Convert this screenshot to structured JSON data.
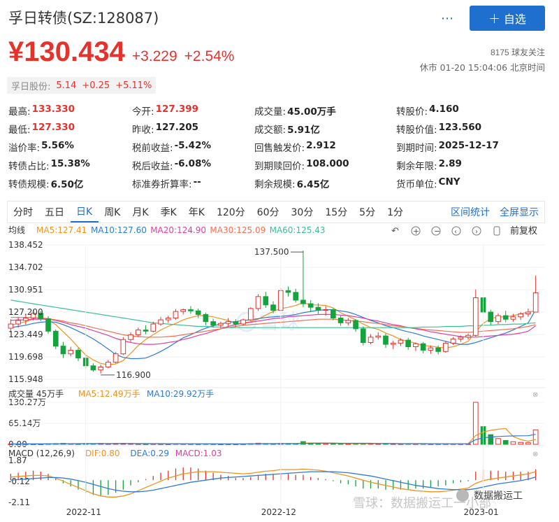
{
  "header": {
    "title": "孚日转债(SZ:128087)",
    "more_icon": "⋯",
    "follow_label": "自选"
  },
  "price": {
    "current": "¥130.434",
    "change": "+3.229",
    "change_pct": "+2.54%",
    "followers": "8175 球友关注",
    "status": "休市 01-20 15:04:06 北京时间"
  },
  "stock_link": {
    "name": "孚日股份:",
    "price": "5.14",
    "change": "+0.25",
    "change_pct": "+5.11%"
  },
  "quote": [
    [
      {
        "label": "最高:",
        "value": "133.330",
        "red": true
      },
      {
        "label": "今开:",
        "value": "127.399",
        "red": true
      },
      {
        "label": "成交量:",
        "value": "45.00万手"
      },
      {
        "label": "转股价:",
        "value": "4.160"
      }
    ],
    [
      {
        "label": "最低:",
        "value": "127.330",
        "red": true
      },
      {
        "label": "昨收:",
        "value": "127.205"
      },
      {
        "label": "成交额:",
        "value": "5.91亿"
      },
      {
        "label": "转股价值:",
        "value": "123.560"
      }
    ],
    [
      {
        "label": "溢价率:",
        "value": "5.56%"
      },
      {
        "label": "税前收益:",
        "value": "-5.42%"
      },
      {
        "label": "回售触发价:",
        "value": "2.912"
      },
      {
        "label": "到期时间:",
        "value": "2025-12-17"
      }
    ],
    [
      {
        "label": "转债占比:",
        "value": "15.38%"
      },
      {
        "label": "税后收益:",
        "value": "-6.08%"
      },
      {
        "label": "到期赎回价:",
        "value": "108.000"
      },
      {
        "label": "剩余年限:",
        "value": "2.89"
      }
    ],
    [
      {
        "label": "转债规模:",
        "value": "6.50亿"
      },
      {
        "label": "标准券折算率:",
        "value": "--"
      },
      {
        "label": "剩余规模:",
        "value": "6.45亿"
      },
      {
        "label": "货币单位:",
        "value": "CNY"
      }
    ]
  ],
  "tabs": {
    "items": [
      "分时",
      "五日",
      "日K",
      "周K",
      "月K",
      "季K",
      "年K",
      "120分",
      "60分",
      "30分",
      "15分",
      "5分",
      "1分"
    ],
    "active": 2,
    "range_stats": "区间统计",
    "fullscreen": "全屏显示"
  },
  "colors": {
    "up": "#e5322d",
    "down": "#14a33c",
    "accent": "#1e6fce",
    "ma5": "#f0921e",
    "ma10": "#2d7bd6",
    "ma20": "#e040a0",
    "ma30": "#f07050",
    "ma60": "#3cc090"
  },
  "chart_data": {
    "type": "candlestick",
    "ma_label": "均线",
    "ma_legend": [
      "MA5:127.41",
      "MA10:127.60",
      "MA20:124.90",
      "MA30:125.09",
      "MA60:125.43"
    ],
    "adjust_label": "前复权",
    "y_ticks": [
      "138.452",
      "134.702",
      "130.951",
      "127.200",
      "123.449",
      "119.698",
      "115.948"
    ],
    "ylim": [
      115.948,
      138.452
    ],
    "max_label": "137.500",
    "min_label": "116.900",
    "candles": [
      [
        124.5,
        126.0,
        125.2,
        123.8
      ],
      [
        125.2,
        126.4,
        125.8,
        124.6
      ],
      [
        125.8,
        126.8,
        126.2,
        125.1
      ],
      [
        126.2,
        127.6,
        127.0,
        125.8
      ],
      [
        127.0,
        127.4,
        126.1,
        125.7
      ],
      [
        126.1,
        126.5,
        124.0,
        123.6
      ],
      [
        124.0,
        124.3,
        121.5,
        121.0
      ],
      [
        121.5,
        122.2,
        120.2,
        119.5
      ],
      [
        120.2,
        121.4,
        120.8,
        119.8
      ],
      [
        120.8,
        121.2,
        119.5,
        119.0
      ],
      [
        119.5,
        120.1,
        118.2,
        117.8
      ],
      [
        118.2,
        118.6,
        117.5,
        117.2
      ],
      [
        117.5,
        118.4,
        118.0,
        116.9
      ],
      [
        118.0,
        119.2,
        118.8,
        117.8
      ],
      [
        118.8,
        120.5,
        120.2,
        118.6
      ],
      [
        120.2,
        123.0,
        122.6,
        120.0
      ],
      [
        122.6,
        123.8,
        123.4,
        122.2
      ],
      [
        123.4,
        124.6,
        124.2,
        123.0
      ],
      [
        124.2,
        125.0,
        124.0,
        123.5
      ],
      [
        124.0,
        125.6,
        125.2,
        123.8
      ],
      [
        125.2,
        126.4,
        125.9,
        124.9
      ],
      [
        125.9,
        126.6,
        126.2,
        125.4
      ],
      [
        126.2,
        127.7,
        127.3,
        125.9
      ],
      [
        127.3,
        127.8,
        127.6,
        126.8
      ],
      [
        127.6,
        128.2,
        127.4,
        126.9
      ],
      [
        127.4,
        127.8,
        126.8,
        126.2
      ],
      [
        126.8,
        127.1,
        125.6,
        125.0
      ],
      [
        125.6,
        126.1,
        125.0,
        124.6
      ],
      [
        125.0,
        125.6,
        125.3,
        124.5
      ],
      [
        125.3,
        126.2,
        125.6,
        124.8
      ],
      [
        125.6,
        126.0,
        125.2,
        124.7
      ],
      [
        125.2,
        126.1,
        125.9,
        124.9
      ],
      [
        125.9,
        128.0,
        127.8,
        125.7
      ],
      [
        127.8,
        130.2,
        129.8,
        127.4
      ],
      [
        129.8,
        130.6,
        128.4,
        127.9
      ],
      [
        128.4,
        129.0,
        127.5,
        127.0
      ],
      [
        127.5,
        131.2,
        130.8,
        127.3
      ],
      [
        130.8,
        131.5,
        130.5,
        129.8
      ],
      [
        130.5,
        131.1,
        129.2,
        128.8
      ],
      [
        129.2,
        137.5,
        128.6,
        128.0
      ],
      [
        128.6,
        129.2,
        128.0,
        127.2
      ],
      [
        128.0,
        128.7,
        127.5,
        126.9
      ],
      [
        127.5,
        128.2,
        127.6,
        126.6
      ],
      [
        127.6,
        127.9,
        126.2,
        125.8
      ],
      [
        126.2,
        126.6,
        125.4,
        124.9
      ],
      [
        125.4,
        126.2,
        125.8,
        125.0
      ],
      [
        125.8,
        126.0,
        124.4,
        123.9
      ],
      [
        124.4,
        124.8,
        122.1,
        121.6
      ],
      [
        122.1,
        123.5,
        123.0,
        121.8
      ],
      [
        123.0,
        123.8,
        123.2,
        122.6
      ],
      [
        123.2,
        123.6,
        121.8,
        121.2
      ],
      [
        121.8,
        122.4,
        122.0,
        121.0
      ],
      [
        122.0,
        122.8,
        122.5,
        121.5
      ],
      [
        122.5,
        122.9,
        121.4,
        120.9
      ],
      [
        121.4,
        122.1,
        121.9,
        120.7
      ],
      [
        121.9,
        122.2,
        120.8,
        120.3
      ],
      [
        120.8,
        121.6,
        121.2,
        120.2
      ],
      [
        121.2,
        121.6,
        120.6,
        120.1
      ],
      [
        120.6,
        122.4,
        122.0,
        120.4
      ],
      [
        122.0,
        123.0,
        122.7,
        121.7
      ],
      [
        122.7,
        123.3,
        123.0,
        122.2
      ],
      [
        123.0,
        123.6,
        123.3,
        122.6
      ],
      [
        123.3,
        131.0,
        129.6,
        123.1
      ],
      [
        129.6,
        130.4,
        127.2,
        126.8
      ],
      [
        127.2,
        127.6,
        125.6,
        125.0
      ],
      [
        125.6,
        127.0,
        126.6,
        125.2
      ],
      [
        126.6,
        127.4,
        126.0,
        125.5
      ],
      [
        126.0,
        126.9,
        126.4,
        125.6
      ],
      [
        126.4,
        127.2,
        126.9,
        125.9
      ],
      [
        126.9,
        127.8,
        127.2,
        126.4
      ],
      [
        127.2,
        133.33,
        130.434,
        127.2
      ]
    ],
    "ma_series": {
      "ma5": [
        125.0,
        125.3,
        125.6,
        126.0,
        126.1,
        125.9,
        125.1,
        123.9,
        122.7,
        121.3,
        120.0,
        119.2,
        118.6,
        118.4,
        118.5,
        119.1,
        120.3,
        121.6,
        122.6,
        123.4,
        124.2,
        124.8,
        125.3,
        125.9,
        126.3,
        126.6,
        126.6,
        126.4,
        126.1,
        125.8,
        125.3,
        125.4,
        125.6,
        126.0,
        126.7,
        127.3,
        127.8,
        128.0,
        128.3,
        128.8,
        128.4,
        128.4,
        128.3,
        127.9,
        127.1,
        126.5,
        125.9,
        125.2,
        124.6,
        124.3,
        123.7,
        123.2,
        122.6,
        122.3,
        122.0,
        121.6,
        121.5,
        121.3,
        121.2,
        121.4,
        121.8,
        122.3,
        123.9,
        125.3,
        126.1,
        126.4,
        126.4,
        126.6,
        126.9,
        127.2,
        127.4
      ],
      "ma10": [
        124.6,
        124.8,
        125.0,
        125.3,
        125.5,
        125.6,
        125.5,
        125.1,
        124.6,
        124.0,
        123.4,
        122.7,
        121.9,
        121.0,
        120.1,
        119.6,
        119.4,
        119.4,
        119.5,
        120.0,
        120.6,
        121.3,
        122.1,
        122.9,
        123.4,
        124.0,
        124.5,
        124.9,
        125.2,
        125.5,
        125.6,
        125.8,
        125.9,
        126.1,
        126.3,
        126.4,
        126.5,
        126.6,
        126.8,
        127.1,
        127.3,
        127.5,
        127.6,
        127.6,
        127.4,
        127.2,
        126.8,
        126.3,
        125.8,
        125.4,
        124.9,
        124.6,
        124.2,
        123.9,
        123.6,
        123.2,
        122.9,
        122.6,
        122.3,
        122.0,
        121.8,
        121.8,
        122.1,
        122.5,
        122.9,
        123.3,
        123.7,
        124.2,
        124.8,
        125.4,
        127.6
      ],
      "ma20": [
        125.8,
        125.9,
        125.9,
        126.0,
        126.0,
        126.0,
        125.8,
        125.5,
        125.1,
        124.8,
        124.5,
        124.1,
        123.7,
        123.3,
        122.8,
        122.4,
        122.1,
        121.9,
        121.8,
        121.8,
        121.9,
        122.1,
        122.3,
        122.6,
        122.9,
        123.3,
        123.6,
        124.0,
        124.4,
        124.8,
        125.1,
        125.3,
        125.5,
        125.7,
        125.9,
        126.1,
        126.2,
        126.4,
        126.5,
        126.6,
        126.7,
        126.8,
        126.8,
        126.8,
        126.7,
        126.6,
        126.4,
        126.2,
        125.9,
        125.7,
        125.4,
        125.1,
        124.9,
        124.6,
        124.4,
        124.2,
        123.9,
        123.7,
        123.5,
        123.3,
        123.1,
        123.0,
        123.0,
        123.1,
        123.2,
        123.3,
        123.4,
        123.5,
        123.7,
        124.0,
        124.9
      ],
      "ma30": [
        126.3,
        126.3,
        126.3,
        126.3,
        126.2,
        126.1,
        125.9,
        125.7,
        125.4,
        125.2,
        124.9,
        124.6,
        124.3,
        124.0,
        123.7,
        123.4,
        123.2,
        123.1,
        123.0,
        123.0,
        123.0,
        123.1,
        123.2,
        123.4,
        123.6,
        123.8,
        124.0,
        124.2,
        124.4,
        124.6,
        124.8,
        125.0,
        125.1,
        125.2,
        125.3,
        125.4,
        125.5,
        125.6,
        125.7,
        125.8,
        125.9,
        126.0,
        126.0,
        126.0,
        125.9,
        125.8,
        125.7,
        125.6,
        125.4,
        125.3,
        125.1,
        124.9,
        124.8,
        124.6,
        124.5,
        124.3,
        124.2,
        124.1,
        124.0,
        123.9,
        123.8,
        123.8,
        123.9,
        124.0,
        124.1,
        124.2,
        124.3,
        124.4,
        124.6,
        124.8,
        125.1
      ],
      "ma60": [
        129.2,
        129.0,
        128.8,
        128.6,
        128.4,
        128.2,
        128.0,
        127.8,
        127.6,
        127.4,
        127.2,
        127.0,
        126.8,
        126.6,
        126.4,
        126.2,
        126.0,
        125.8,
        125.6,
        125.4,
        125.3,
        125.2,
        125.1,
        125.0,
        124.9,
        124.8,
        124.8,
        124.7,
        124.7,
        124.6,
        124.6,
        124.6,
        124.6,
        124.6,
        124.6,
        124.6,
        124.6,
        124.6,
        124.6,
        124.6,
        124.6,
        124.6,
        124.6,
        124.6,
        124.6,
        124.6,
        124.6,
        124.6,
        124.6,
        124.6,
        124.6,
        124.6,
        124.6,
        124.6,
        124.6,
        124.7,
        124.7,
        124.7,
        124.8,
        124.8,
        124.8,
        124.9,
        124.9,
        125.0,
        125.0,
        125.1,
        125.1,
        125.2,
        125.2,
        125.3,
        125.4
      ]
    },
    "volume": {
      "label": "成交量 45万手",
      "ma_legend": [
        "MA5:12.49万手",
        "MA10:29.92万手"
      ],
      "y_ticks": [
        "130.27万",
        "65.14万",
        "0.00"
      ],
      "ylim": [
        0,
        130.27
      ],
      "values": [
        1.2,
        1.0,
        1.5,
        1.3,
        1.1,
        2.0,
        2.5,
        3.2,
        2.1,
        1.8,
        2.6,
        2.2,
        2.8,
        1.9,
        2.4,
        3.1,
        2.2,
        1.6,
        1.4,
        1.7,
        1.5,
        1.3,
        2.0,
        1.8,
        1.6,
        1.4,
        1.9,
        1.5,
        1.2,
        1.3,
        1.1,
        1.4,
        2.3,
        3.5,
        2.6,
        2.0,
        3.0,
        2.4,
        2.2,
        8.5,
        4.2,
        3.1,
        2.5,
        2.8,
        2.1,
        1.7,
        2.6,
        3.2,
        2.4,
        1.9,
        2.3,
        1.8,
        1.6,
        2.0,
        1.7,
        1.9,
        1.5,
        1.6,
        1.8,
        1.7,
        1.5,
        1.6,
        130.27,
        55.0,
        30.0,
        18.0,
        12.0,
        8.0,
        6.0,
        5.0,
        45.0
      ]
    },
    "macd": {
      "label": "MACD (12,26,9)",
      "legend": [
        "DIF:0.80",
        "DEA:0.29",
        "MACD:1.03"
      ],
      "y_ticks": [
        "1.87",
        "-0.12",
        "-2.11"
      ],
      "ylim": [
        -2.11,
        1.87
      ],
      "hist": [
        0.6,
        0.7,
        0.8,
        0.9,
        0.8,
        0.6,
        0.2,
        -0.3,
        -0.6,
        -0.9,
        -1.2,
        -1.4,
        -1.5,
        -1.4,
        -1.2,
        -0.9,
        -0.5,
        -0.2,
        0.1,
        0.4,
        0.7,
        0.9,
        1.1,
        1.2,
        1.2,
        1.1,
        0.9,
        0.7,
        0.5,
        0.4,
        0.2,
        0.2,
        0.3,
        0.5,
        0.6,
        0.6,
        0.7,
        0.6,
        0.5,
        0.5,
        0.3,
        0.2,
        0.1,
        -0.1,
        -0.3,
        -0.4,
        -0.6,
        -0.8,
        -0.8,
        -0.8,
        -0.9,
        -0.9,
        -0.9,
        -0.9,
        -0.8,
        -0.8,
        -0.7,
        -0.6,
        -0.5,
        -0.3,
        -0.2,
        -0.1,
        0.8,
        1.0,
        0.9,
        0.9,
        0.8,
        0.8,
        0.8,
        0.8,
        1.03
      ],
      "dif": [
        0.3,
        0.35,
        0.4,
        0.45,
        0.45,
        0.4,
        0.2,
        -0.1,
        -0.4,
        -0.7,
        -1.0,
        -1.3,
        -1.5,
        -1.6,
        -1.6,
        -1.5,
        -1.3,
        -1.0,
        -0.7,
        -0.4,
        -0.1,
        0.2,
        0.4,
        0.6,
        0.7,
        0.8,
        0.8,
        0.8,
        0.75,
        0.7,
        0.65,
        0.6,
        0.65,
        0.75,
        0.85,
        0.9,
        1.0,
        1.0,
        1.0,
        1.05,
        1.0,
        0.95,
        0.85,
        0.7,
        0.55,
        0.4,
        0.2,
        0.0,
        -0.2,
        -0.35,
        -0.5,
        -0.65,
        -0.8,
        -0.9,
        -1.0,
        -1.05,
        -1.1,
        -1.1,
        -1.05,
        -0.95,
        -0.85,
        -0.75,
        -0.3,
        -0.05,
        0.1,
        0.2,
        0.3,
        0.4,
        0.5,
        0.6,
        0.8
      ],
      "dea": [
        0.0,
        0.05,
        0.1,
        0.15,
        0.2,
        0.25,
        0.25,
        0.2,
        0.1,
        -0.05,
        -0.2,
        -0.4,
        -0.6,
        -0.8,
        -0.95,
        -1.05,
        -1.1,
        -1.1,
        -1.05,
        -0.95,
        -0.8,
        -0.65,
        -0.5,
        -0.35,
        -0.2,
        -0.1,
        0.0,
        0.1,
        0.2,
        0.25,
        0.3,
        0.35,
        0.4,
        0.45,
        0.5,
        0.55,
        0.6,
        0.65,
        0.7,
        0.75,
        0.8,
        0.8,
        0.8,
        0.8,
        0.75,
        0.7,
        0.6,
        0.5,
        0.4,
        0.25,
        0.1,
        -0.05,
        -0.2,
        -0.35,
        -0.5,
        -0.6,
        -0.7,
        -0.8,
        -0.85,
        -0.9,
        -0.9,
        -0.9,
        -0.8,
        -0.65,
        -0.5,
        -0.35,
        -0.25,
        -0.15,
        -0.05,
        0.1,
        0.29
      ]
    },
    "x_ticks": [
      {
        "label": "2022-11",
        "index": 10
      },
      {
        "label": "2022-12",
        "index": 36
      },
      {
        "label": "2023-01",
        "index": 63
      }
    ]
  },
  "watermark": "雪球",
  "footer_watermark": "雪球：数据搬运工一小部",
  "wechat_watermark": "数据搬运工"
}
